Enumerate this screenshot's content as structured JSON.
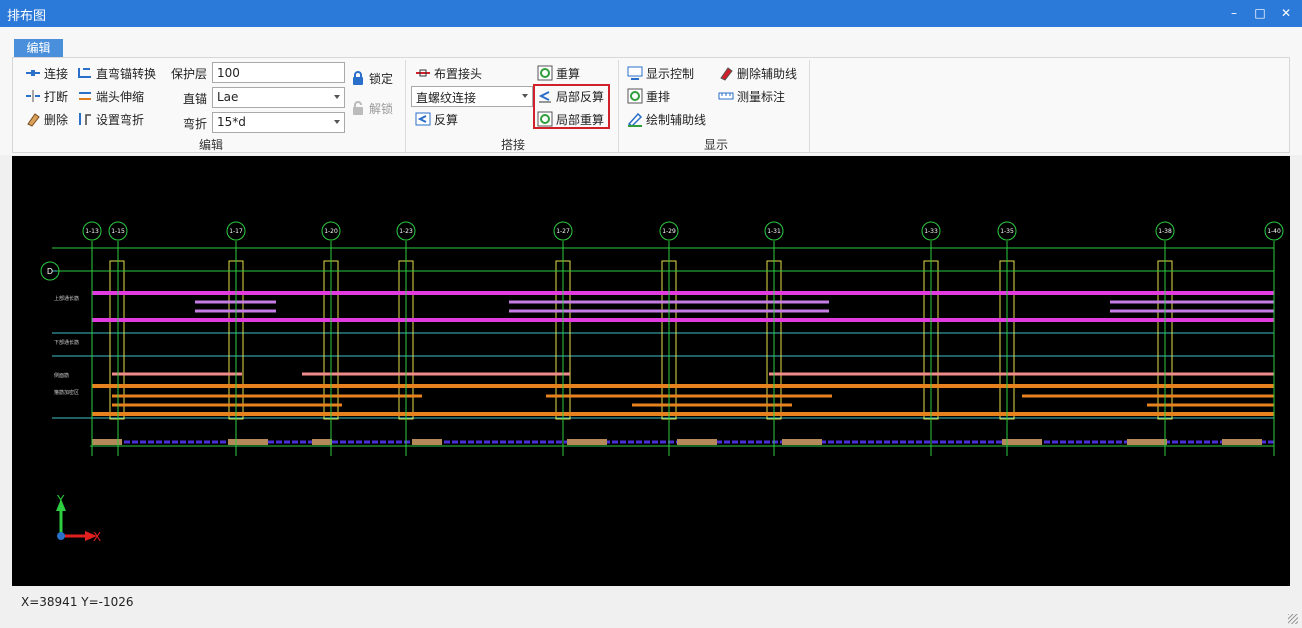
{
  "window": {
    "title": "排布图",
    "minimize_icon": "minimize-icon",
    "maximize_icon": "maximize-icon",
    "close_icon": "close-icon"
  },
  "ribbon": {
    "tab": "编辑",
    "groups": {
      "edit": {
        "label": "编辑",
        "connect": "连接",
        "break": "打断",
        "delete": "删除",
        "straight_to_bend": "直弯锚转换",
        "end_stretch": "端头伸缩",
        "set_bend": "设置弯折",
        "cover_label": "保护层",
        "cover_value": "100",
        "straight_anchor_label": "直锚",
        "straight_anchor_value": "Lae",
        "bend_label": "弯折",
        "bend_value": "15*d",
        "lock": "锁定",
        "unlock": "解锁"
      },
      "splice": {
        "label": "搭接",
        "place_joint": "布置接头",
        "joint_type_value": "直螺纹连接",
        "reverse_calc": "反算",
        "recalc": "重算",
        "partial_reverse": "局部反算",
        "partial_recalc": "局部重算"
      },
      "display": {
        "label": "显示",
        "display_control": "显示控制",
        "rearrange": "重排",
        "draw_aux_line": "绘制辅助线",
        "delete_aux_line": "删除辅助线",
        "measure_mark": "测量标注"
      }
    }
  },
  "canvas": {
    "axis_top_labels": [
      "1-13",
      "1-15",
      "1-17",
      "1-20",
      "1-23",
      "1-27",
      "1-29",
      "1-31",
      "1-33",
      "1-35",
      "1-38",
      "1-40"
    ],
    "axis_left_label": "D",
    "row_labels": [
      "上部通长筋",
      "下部通长筋",
      "侧面筋",
      "箍筋加密区"
    ],
    "ucs_y": "Y",
    "ucs_x": "X"
  },
  "status": {
    "coords": "X=38941 Y=-1026"
  },
  "colors": {
    "titlebar": "#2b79d8",
    "accent": "#4a8fdc",
    "canvas_bg": "#000000",
    "highlight": "#d0202a"
  }
}
